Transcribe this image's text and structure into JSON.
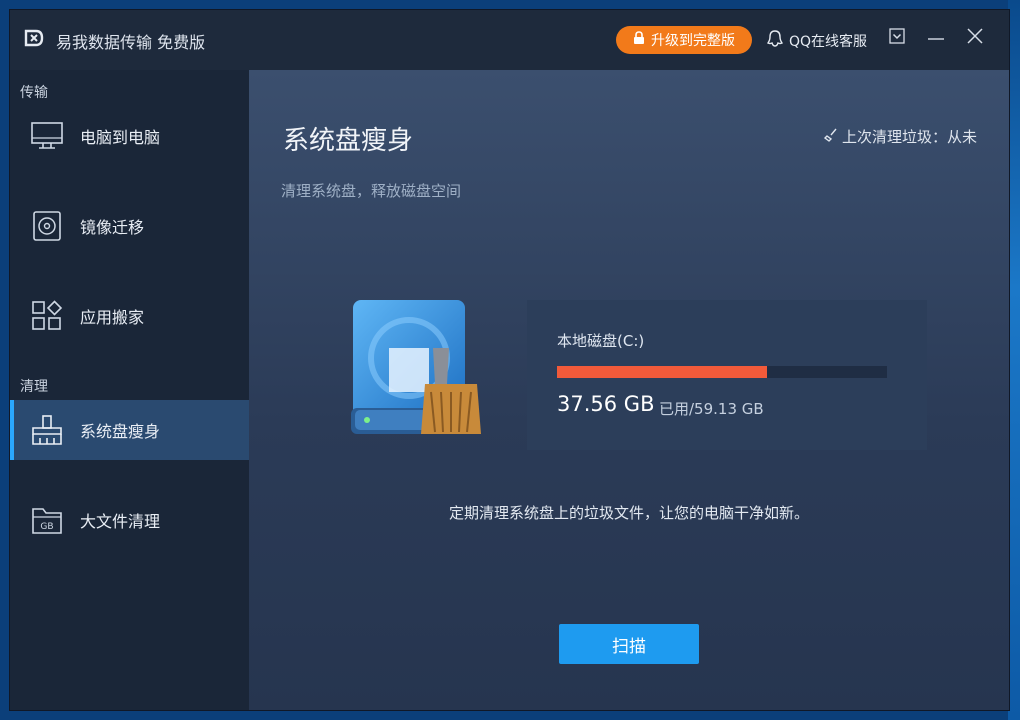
{
  "titlebar": {
    "title": "易我数据传输 免费版",
    "upgrade_label": "升级到完整版",
    "support_label": "QQ在线客服"
  },
  "sidebar": {
    "sections": [
      {
        "label": "传输"
      },
      {
        "label": "清理"
      }
    ],
    "items": [
      {
        "label": "电脑到电脑",
        "icon": "monitor-icon"
      },
      {
        "label": "镜像迁移",
        "icon": "disc-icon"
      },
      {
        "label": "应用搬家",
        "icon": "apps-grid-icon"
      },
      {
        "label": "系统盘瘦身",
        "icon": "broom-icon",
        "active": true
      },
      {
        "label": "大文件清理",
        "icon": "gb-folder-icon"
      }
    ]
  },
  "main": {
    "title": "系统盘瘦身",
    "subtitle": "清理系统盘，释放磁盘空间",
    "last_clean_label": "上次清理垃圾：从未",
    "disk": {
      "name": "本地磁盘(C:)",
      "used": "37.56 GB",
      "total_label": "已用/59.13 GB",
      "used_fraction": 0.635
    },
    "tip": "定期清理系统盘上的垃圾文件，让您的电脑干净如新。",
    "scan_label": "扫描"
  },
  "colors": {
    "accent": "#1e9bf0",
    "upgrade": "#f27a1a",
    "usage_bar": "#f25a3a",
    "active_item": "#2a4a70"
  }
}
